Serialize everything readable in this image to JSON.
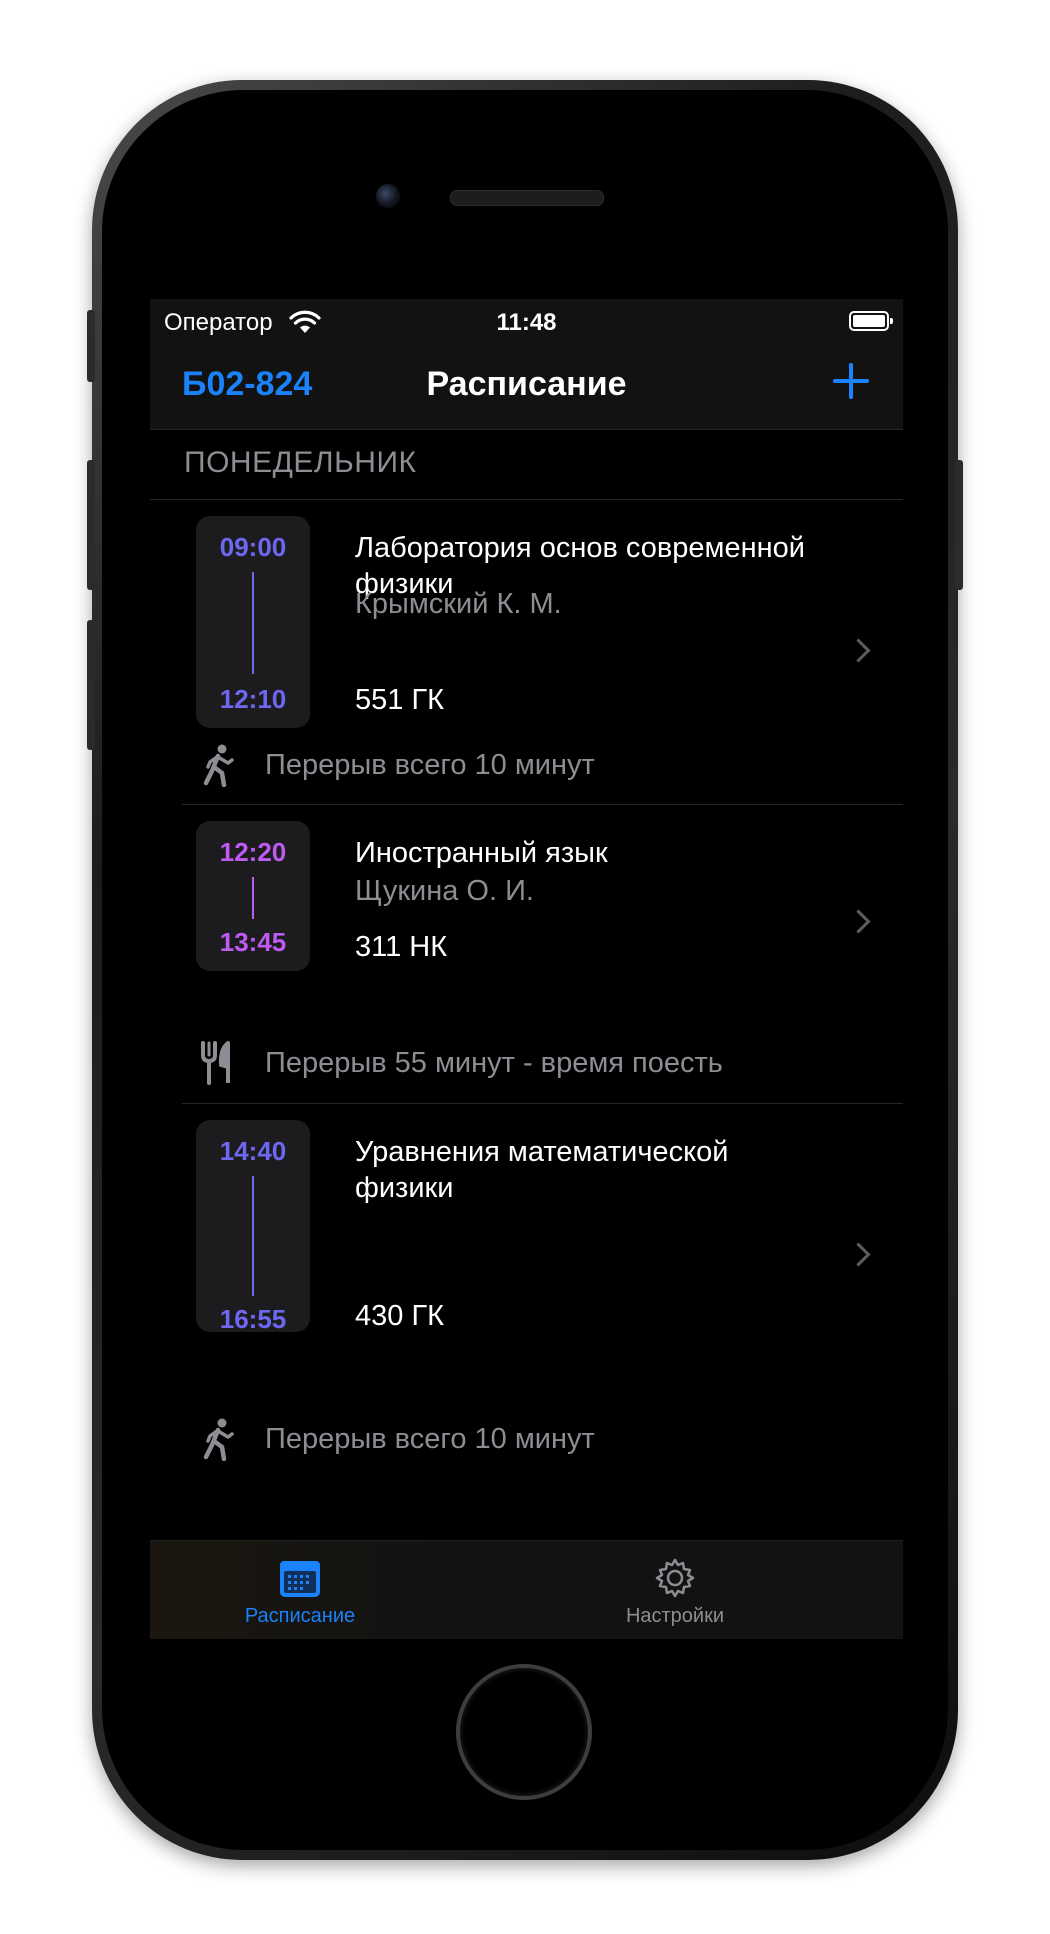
{
  "statusbar": {
    "carrier": "Оператор",
    "time": "11:48"
  },
  "navbar": {
    "left_label": "Б02-824",
    "title": "Расписание"
  },
  "section": {
    "day": "ПОНЕДЕЛЬНИК"
  },
  "lessons": [
    {
      "start": "09:00",
      "end": "12:10",
      "title": "Лаборатория основ современной физики",
      "teacher": "Крымский К. М.",
      "room": "551 ГК",
      "accent": "#6e67f2",
      "break": {
        "icon": "walking-person-icon",
        "text": "Перерыв всего 10 минут"
      }
    },
    {
      "start": "12:20",
      "end": "13:45",
      "title": "Иностранный язык",
      "teacher": "Щукина О. И.",
      "room": "311 НК",
      "accent": "#bf5af2",
      "break": {
        "icon": "fork-knife-icon",
        "text": "Перерыв 55 минут - время поесть"
      }
    },
    {
      "start": "14:40",
      "end": "16:55",
      "title": "Уравнения математической физики",
      "teacher": "",
      "room": "430 ГК",
      "accent": "#6e67f2",
      "break": {
        "icon": "walking-person-icon",
        "text": "Перерыв всего 10 минут"
      }
    }
  ],
  "tabbar": {
    "tabs": [
      {
        "label": "Расписание",
        "icon": "calendar-icon",
        "active": true
      },
      {
        "label": "Настройки",
        "icon": "gear-icon",
        "active": false
      }
    ]
  },
  "colors": {
    "accent_blue": "#1a82fb",
    "secondary_text": "#8d8d93",
    "background": "#000000",
    "bar_background": "#121212"
  }
}
